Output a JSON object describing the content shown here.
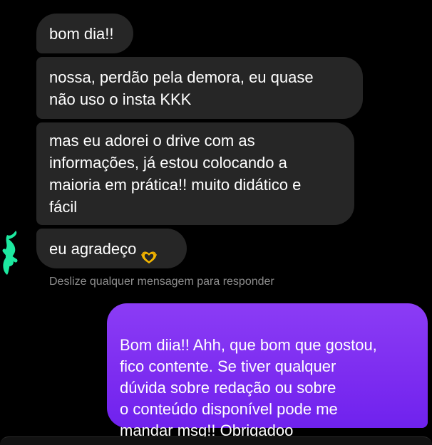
{
  "messages": {
    "incoming": [
      "bom dia!!",
      "nossa, perdão pela demora, eu quase\nnão uso o insta KKK",
      "mas eu adorei o drive com as\ninformações, já estou colocando a\nmaioria em prática!! muito didático e\nfácil",
      "eu agradeço"
    ],
    "incoming_emoji": "heart-hands-emoji",
    "outgoing": "Bom diia!! Ahh, que bom que gostou,\nfico contente. Se tiver qualquer\ndúvida sobre redação ou sobre\no conteúdo disponível pode me\nmandar msg!! Obrigadoo"
  },
  "hint": "Deslize qualquer mensagem para responder",
  "colors": {
    "background": "#000000",
    "incoming_bubble": "#262626",
    "outgoing_bubble": "#7c2cf0",
    "hint_text": "#8e8e8e",
    "scribble": "#1de9a0"
  }
}
